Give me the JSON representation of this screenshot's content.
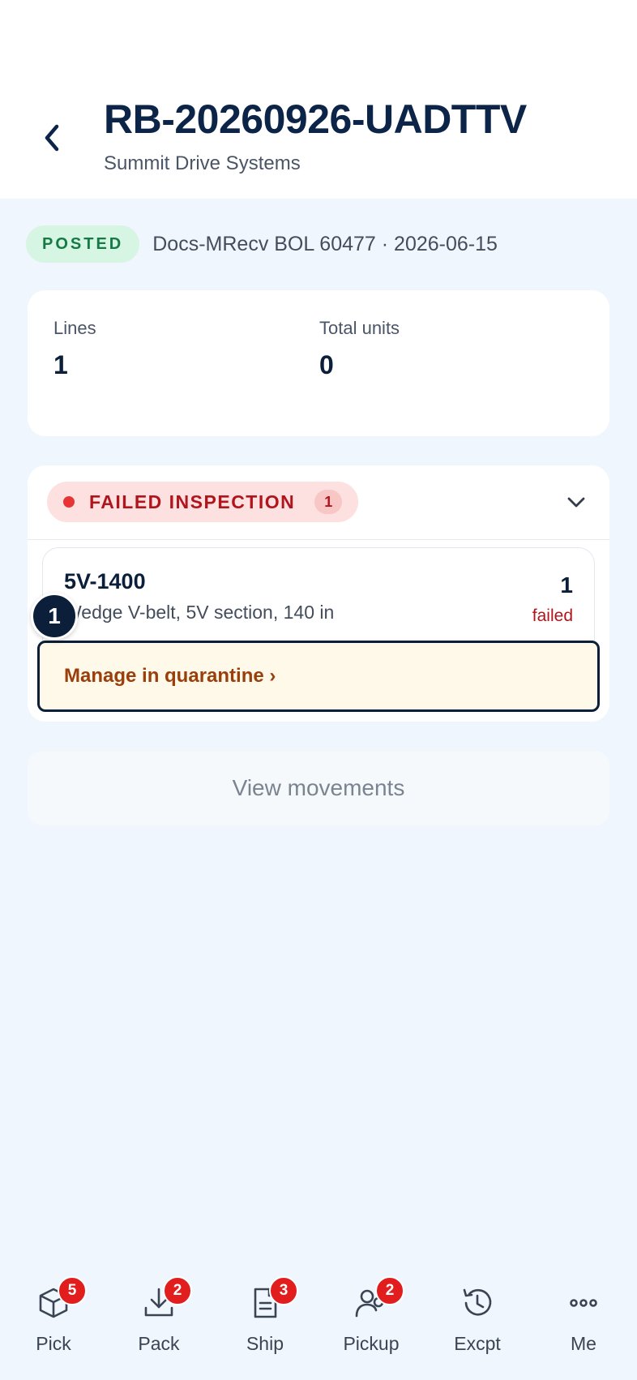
{
  "header": {
    "title": "RB-20260926-UADTTV",
    "subtitle": "Summit Drive Systems"
  },
  "status": {
    "label": "POSTED",
    "meta": "Docs-MRecv BOL 60477 · 2026-06-15"
  },
  "stats": {
    "lines_label": "Lines",
    "lines_value": "1",
    "units_label": "Total units",
    "units_value": "0"
  },
  "failed_section": {
    "label": "FAILED INSPECTION",
    "count": "1",
    "items": [
      {
        "sku": "5V-1400",
        "description": "Wedge V-belt, 5V section, 140 in",
        "qty": "1",
        "qty_label": "failed"
      }
    ],
    "action_label": "Manage in quarantine ›"
  },
  "step_badge": "1",
  "view_movements_label": "View movements",
  "tabs": [
    {
      "label": "Pick",
      "badge": "5",
      "icon": "box-icon"
    },
    {
      "label": "Pack",
      "badge": "2",
      "icon": "download-icon"
    },
    {
      "label": "Ship",
      "badge": "3",
      "icon": "document-icon"
    },
    {
      "label": "Pickup",
      "badge": "2",
      "icon": "users-icon"
    },
    {
      "label": "Excpt",
      "badge": "",
      "icon": "history-icon"
    },
    {
      "label": "Me",
      "badge": "",
      "icon": "more-icon"
    }
  ],
  "colors": {
    "primary": "#0b1f3a",
    "posted_bg": "#d6f5e3",
    "posted_text": "#157a45",
    "failed_bg": "#fde0e0",
    "failed_text": "#b0141c",
    "badge": "#e11d1d",
    "quarantine_bg": "#fef9e8",
    "quarantine_text": "#9a3f0c"
  }
}
